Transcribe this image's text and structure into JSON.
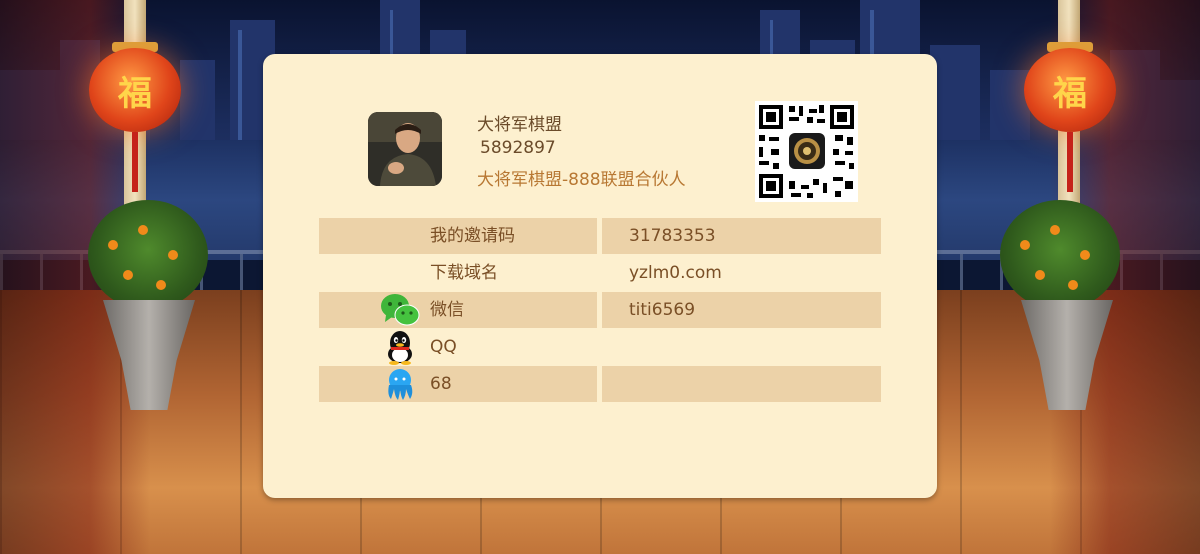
{
  "profile": {
    "name": "大将军棋盟",
    "id": "5892897",
    "title": "大将军棋盟-888联盟合伙人"
  },
  "rows": [
    {
      "label": "我的邀请码",
      "value": "31783353",
      "icon": ""
    },
    {
      "label": "下载域名",
      "value": "yzlm0.com",
      "icon": ""
    },
    {
      "label": "微信",
      "value": "titi6569",
      "icon": "wechat-icon"
    },
    {
      "label": "QQ",
      "value": "",
      "icon": "qq-icon"
    },
    {
      "label": "68",
      "value": "",
      "icon": "octopus-icon"
    }
  ],
  "background": {
    "lantern_text": "福"
  },
  "colors": {
    "panel": "#fdf0cf",
    "row_shade": "#ecd2a8",
    "text": "#7a4f26",
    "accent_title": "#b87833"
  }
}
